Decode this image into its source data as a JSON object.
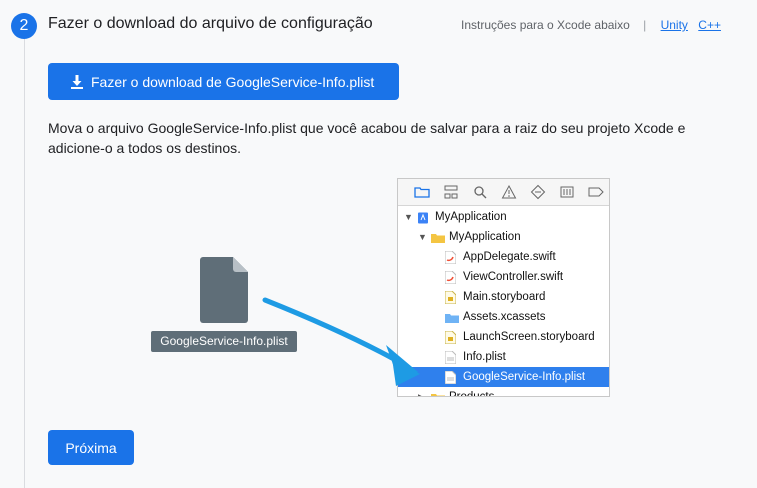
{
  "step": {
    "number": "2",
    "title": "Fazer o download do arquivo de configuração",
    "instructions_label": "Instruções para o Xcode abaixo",
    "separator": "|",
    "links": [
      "Unity",
      "C++"
    ]
  },
  "download_button": "Fazer o download de GoogleService-Info.plist",
  "description": "Mova o arquivo GoogleService-Info.plist que você acabou de salvar para a raiz do seu projeto Xcode e adicione-o a todos os destinos.",
  "file_label": "GoogleService-Info.plist",
  "xcode_tree": [
    {
      "label": "MyApplication",
      "level": 0,
      "icon": "project-icon",
      "expanded": true
    },
    {
      "label": "MyApplication",
      "level": 1,
      "icon": "folder-icon",
      "expanded": true
    },
    {
      "label": "AppDelegate.swift",
      "level": 2,
      "icon": "swift-file-icon"
    },
    {
      "label": "ViewController.swift",
      "level": 2,
      "icon": "swift-file-icon"
    },
    {
      "label": "Main.storyboard",
      "level": 2,
      "icon": "storyboard-icon"
    },
    {
      "label": "Assets.xcassets",
      "level": 2,
      "icon": "assets-folder-icon"
    },
    {
      "label": "LaunchScreen.storyboard",
      "level": 2,
      "icon": "storyboard-icon"
    },
    {
      "label": "Info.plist",
      "level": 2,
      "icon": "plist-icon"
    },
    {
      "label": "GoogleService-Info.plist",
      "level": 2,
      "icon": "plist-icon",
      "selected": true
    },
    {
      "label": "Products",
      "level": 1,
      "icon": "folder-icon",
      "expanded": false
    }
  ],
  "next_button": "Próxima",
  "colors": {
    "accent": "#1a73e8",
    "arrow": "#1e9be4",
    "selection": "#2f80ed"
  }
}
